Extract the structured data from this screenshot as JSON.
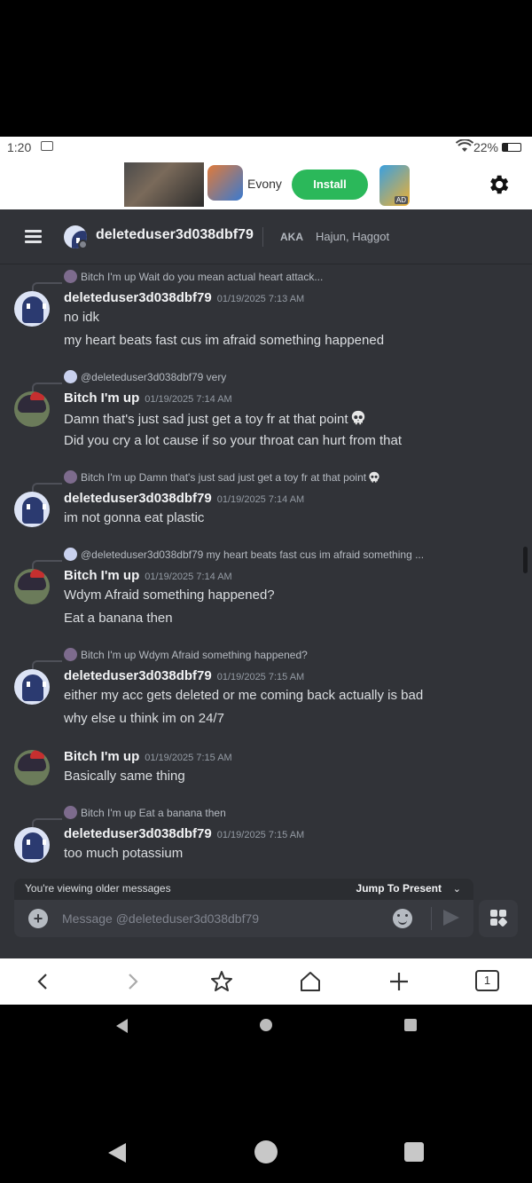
{
  "status_bar": {
    "time": "1:20",
    "battery": "22%"
  },
  "ad": {
    "app_name": "Evony",
    "install_label": "Install",
    "ad_tag": "AD"
  },
  "header": {
    "username": "deleteduser3d038dbf79",
    "aka_label": "AKA",
    "aka_names": "Hajun, Haggot"
  },
  "messages": [
    {
      "reply_author": "Bitch I'm up",
      "reply_text": "Wait do you mean actual heart attack...",
      "author": "deleteduser3d038dbf79",
      "timestamp": "01/19/2025 7:13 AM",
      "lines": [
        "no idk",
        "my heart beats fast cus im afraid something happened"
      ]
    },
    {
      "reply_author": "@deleteduser3d038dbf79",
      "reply_text": "very",
      "author": "Bitch I'm up",
      "timestamp": "01/19/2025 7:14 AM",
      "lines": [
        "Damn that's just sad just get a toy fr at that point",
        "Did you cry a lot cause if so your throat can hurt from that"
      ]
    },
    {
      "reply_author": "Bitch I'm up",
      "reply_text": "Damn that's just sad just get a toy fr at that point",
      "author": "deleteduser3d038dbf79",
      "timestamp": "01/19/2025 7:14 AM",
      "lines": [
        "im not gonna eat plastic"
      ]
    },
    {
      "reply_author": "@deleteduser3d038dbf79",
      "reply_text": "my heart beats fast cus im afraid something ...",
      "author": "Bitch I'm up",
      "timestamp": "01/19/2025 7:14 AM",
      "lines": [
        "Wdym Afraid something happened?",
        "Eat a banana then"
      ]
    },
    {
      "reply_author": "Bitch I'm up",
      "reply_text": "Wdym Afraid something happened?",
      "author": "deleteduser3d038dbf79",
      "timestamp": "01/19/2025 7:15 AM",
      "lines": [
        "either my acc gets deleted or me coming back actually is bad",
        "why else u think im on 24/7"
      ]
    },
    {
      "author": "Bitch I'm up",
      "timestamp": "01/19/2025 7:15 AM",
      "lines": [
        "Basically same thing"
      ]
    },
    {
      "reply_author": "Bitch I'm up",
      "reply_text": "Eat a banana then",
      "author": "deleteduser3d038dbf79",
      "timestamp": "01/19/2025 7:15 AM",
      "lines": [
        "too much potassium"
      ]
    }
  ],
  "older_banner": {
    "label": "You're viewing older messages",
    "jump": "Jump To Present"
  },
  "composer": {
    "placeholder": "Message @deleteduser3d038dbf79"
  },
  "browser_nav": {
    "tab_count": "1"
  },
  "icons": {
    "skull": "skull-icon",
    "menu": "hamburger-icon",
    "settings": "gear-icon",
    "send": "send-icon",
    "emoji": "emoji-icon",
    "add": "plus-icon",
    "apps": "apps-icon"
  },
  "colors": {
    "background": "#313338",
    "install": "#2bb85a",
    "text": "#dbdee1",
    "muted": "#949ba4"
  }
}
